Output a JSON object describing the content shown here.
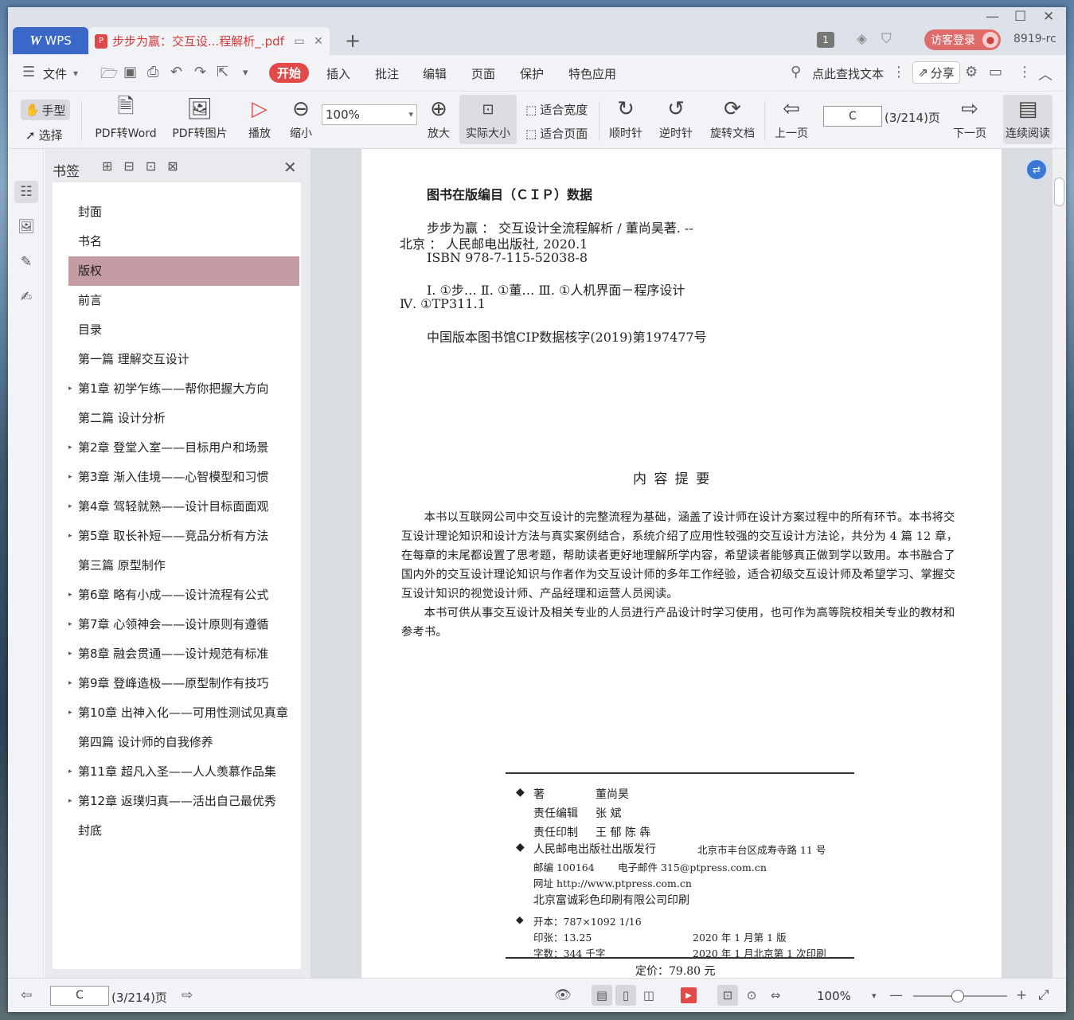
{
  "titlebar": {
    "app_tab": "WPS",
    "doc_tab": "步步为赢：交互设...程解析_.pdf",
    "badge": "1",
    "login": "访客登录",
    "user": "8919-rc"
  },
  "menu": {
    "file": "文件",
    "start": "开始",
    "insert": "插入",
    "annotate": "批注",
    "edit": "编辑",
    "page": "页面",
    "protect": "保护",
    "special": "特色应用",
    "search": "点此查找文本",
    "share": "分享"
  },
  "ribbon": {
    "hand": "手型",
    "select": "选择",
    "pdf_to_word": "PDF转Word",
    "pdf_to_image": "PDF转图片",
    "play": "播放",
    "zoom_out": "缩小",
    "zoom_value": "100%",
    "zoom_in": "放大",
    "actual_size": "实际大小",
    "fit_width": "适合宽度",
    "fit_page": "适合页面",
    "clockwise": "顺时针",
    "counter_clockwise": "逆时针",
    "rotate_doc": "旋转文档",
    "prev_page": "上一页",
    "page_input": "C",
    "page_total": "(3/214)页",
    "next_page": "下一页",
    "continuous": "连续阅读"
  },
  "bookmarks": {
    "title": "书签",
    "items": [
      {
        "label": "封面",
        "has_children": false,
        "selected": false
      },
      {
        "label": "书名",
        "has_children": false,
        "selected": false
      },
      {
        "label": "版权",
        "has_children": false,
        "selected": true
      },
      {
        "label": "前言",
        "has_children": false,
        "selected": false
      },
      {
        "label": "目录",
        "has_children": false,
        "selected": false
      },
      {
        "label": "第一篇  理解交互设计",
        "has_children": false,
        "selected": false
      },
      {
        "label": "第1章  初学乍练——帮你把握大方向",
        "has_children": true,
        "selected": false
      },
      {
        "label": "第二篇  设计分析",
        "has_children": false,
        "selected": false
      },
      {
        "label": "第2章  登堂入室——目标用户和场景",
        "has_children": true,
        "selected": false
      },
      {
        "label": "第3章  渐入佳境——心智模型和习惯",
        "has_children": true,
        "selected": false
      },
      {
        "label": "第4章  驾轻就熟——设计目标面面观",
        "has_children": true,
        "selected": false
      },
      {
        "label": "第5章  取长补短——竞品分析有方法",
        "has_children": true,
        "selected": false
      },
      {
        "label": "第三篇  原型制作",
        "has_children": false,
        "selected": false
      },
      {
        "label": "第6章  略有小成——设计流程有公式",
        "has_children": true,
        "selected": false
      },
      {
        "label": "第7章  心领神会——设计原则有遵循",
        "has_children": true,
        "selected": false
      },
      {
        "label": "第8章  融会贯通——设计规范有标准",
        "has_children": true,
        "selected": false
      },
      {
        "label": "第9章  登峰造极——原型制作有技巧",
        "has_children": true,
        "selected": false
      },
      {
        "label": "第10章  出神入化——可用性测试见真章",
        "has_children": true,
        "selected": false
      },
      {
        "label": "第四篇  设计师的自我修养",
        "has_children": false,
        "selected": false
      },
      {
        "label": "第11章  超凡入圣——人人羡慕作品集",
        "has_children": true,
        "selected": false
      },
      {
        "label": "第12章  返璞归真——活出自己最优秀",
        "has_children": true,
        "selected": false
      },
      {
        "label": "封底",
        "has_children": false,
        "selected": false
      }
    ]
  },
  "doc": {
    "cip_title": "图书在版编目（ＣＩＰ）数据",
    "cip_line1": "步步为赢 ： 交互设计全流程解析 / 董尚昊著. --",
    "cip_line2": "北京 ： 人民邮电出版社, 2020.1",
    "cip_line3": "ISBN 978-7-115-52038-8",
    "cip_line4": "Ⅰ. ①步… Ⅱ. ①董… Ⅲ. ①人机界面－程序设计",
    "cip_line5": "Ⅳ. ①TP311.1",
    "cip_line6": "中国版本图书馆CIP数据核字(2019)第197477号",
    "summary_title": "内 容 提 要",
    "summary_p1": "本书以互联网公司中交互设计的完整流程为基础，涵盖了设计师在设计方案过程中的所有环节。本书将交互设计理论知识和设计方法与真实案例结合，系统介绍了应用性较强的交互设计方法论，共分为 4 篇 12 章，在每章的末尾都设置了思考题，帮助读者更好地理解所学内容，希望读者能够真正做到学以致用。本书融合了国内外的交互设计理论知识与作者作为交互设计师的多年工作经验，适合初级交互设计师及希望学习、掌握交互设计知识的视觉设计师、产品经理和运营人员阅读。",
    "summary_p2": "本书可供从事交互设计及相关专业的人员进行产品设计时学习使用，也可作为高等院校相关专业的教材和参考书。",
    "imp_author_label": "著",
    "imp_author": "董尚昊",
    "imp_editor_label": "责任编辑",
    "imp_editor": "张    斌",
    "imp_print_label": "责任印制",
    "imp_print": "王    郁    陈    犇",
    "imp_publisher": "人民邮电出版社出版发行",
    "imp_address": "北京市丰台区成寿寺路 11 号",
    "imp_postcode": "邮编    100164",
    "imp_email": "电子邮件    315@ptpress.com.cn",
    "imp_url": "网址    http://www.ptpress.com.cn",
    "imp_printer": "北京富诚彩色印刷有限公司印刷",
    "imp_format": "开本：787×1092    1/16",
    "imp_sheets": "印张：13.25",
    "imp_edition": "2020 年 1 月第 1 版",
    "imp_words": "字数：344 千字",
    "imp_printing": "2020 年 1 月北京第 1 次印刷",
    "imp_price": "定价：79.80 元"
  },
  "status": {
    "page_input": "C",
    "page_total": "(3/214)页",
    "zoom": "100%"
  },
  "colors": {
    "accent": "#e24a4a",
    "wps_blue": "#3a68c9",
    "selected_bookmark": "#c59ca3"
  }
}
